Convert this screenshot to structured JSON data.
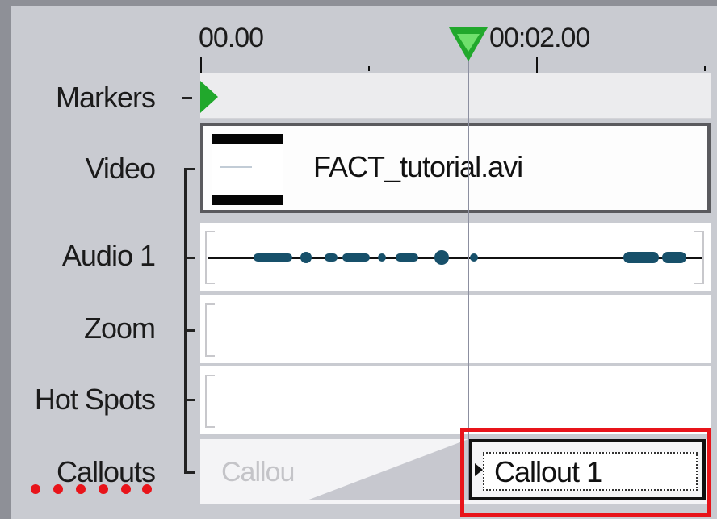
{
  "ruler": {
    "start_label": "00.00",
    "mid_label": "00:02.00"
  },
  "tracks": {
    "markers": "Markers",
    "video": "Video",
    "audio": "Audio 1",
    "zoom": "Zoom",
    "hotspots": "Hot Spots",
    "callouts": "Callouts"
  },
  "clips": {
    "video_file": "FACT_tutorial.avi",
    "callout_ghost": "Callou",
    "callout_selected": "Callout 1"
  },
  "colors": {
    "playhead": "#21a82c",
    "highlight": "#e8141a",
    "waveform": "#17506a"
  },
  "icons": {
    "playhead": "playhead-triangle-icon",
    "marker": "marker-flag-icon",
    "spell_check": "spell-check-squiggle-icon"
  }
}
